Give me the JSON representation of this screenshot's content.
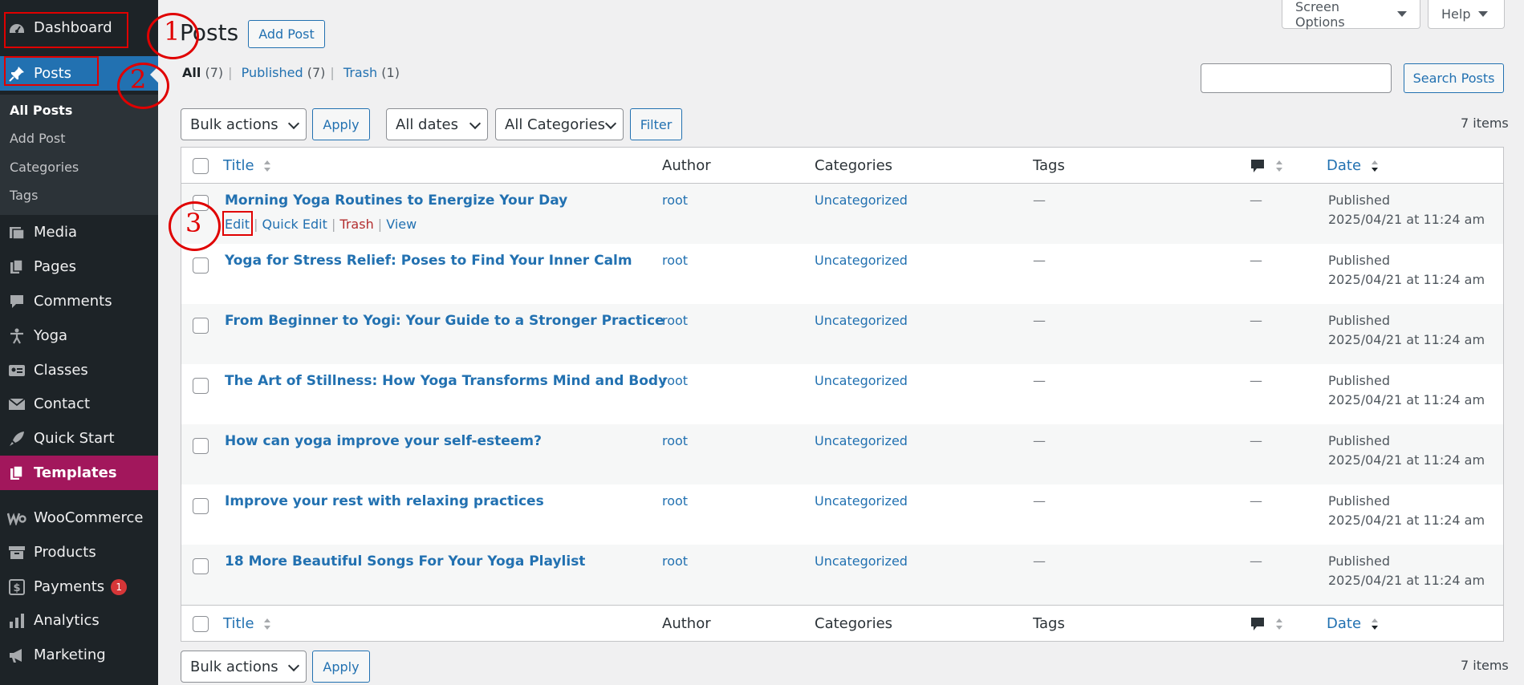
{
  "sidebar": {
    "items": [
      {
        "label": "Dashboard",
        "icon": "dashboard-icon"
      },
      {
        "label": "Posts",
        "icon": "pin-icon"
      },
      {
        "label": "Media",
        "icon": "media-icon"
      },
      {
        "label": "Pages",
        "icon": "pages-icon"
      },
      {
        "label": "Comments",
        "icon": "comments-icon"
      },
      {
        "label": "Yoga",
        "icon": "person-icon"
      },
      {
        "label": "Classes",
        "icon": "classes-icon"
      },
      {
        "label": "Contact",
        "icon": "mail-icon"
      },
      {
        "label": "Quick Start",
        "icon": "rocket-icon"
      },
      {
        "label": "Templates",
        "icon": "templates-icon"
      },
      {
        "label": "WooCommerce",
        "icon": "woo-icon"
      },
      {
        "label": "Products",
        "icon": "archive-icon"
      },
      {
        "label": "Payments",
        "icon": "dollar-icon",
        "badge": "1"
      },
      {
        "label": "Analytics",
        "icon": "bar-chart-icon"
      },
      {
        "label": "Marketing",
        "icon": "megaphone-icon"
      }
    ],
    "submenu": [
      "All Posts",
      "Add Post",
      "Categories",
      "Tags"
    ]
  },
  "header": {
    "title": "Posts",
    "add_button": "Add Post",
    "screen_options": "Screen Options",
    "help": "Help"
  },
  "filters": {
    "all": "All",
    "all_count": "(7)",
    "published": "Published",
    "published_count": "(7)",
    "trash": "Trash",
    "trash_count": "(1)",
    "search_button": "Search Posts",
    "bulk_actions": "Bulk actions",
    "apply": "Apply",
    "all_dates": "All dates",
    "all_categories": "All Categories",
    "filter": "Filter",
    "items_count": "7 items"
  },
  "table": {
    "columns": {
      "title": "Title",
      "author": "Author",
      "categories": "Categories",
      "tags": "Tags",
      "date": "Date"
    },
    "rows": [
      {
        "title": "Morning Yoga Routines to Energize Your Day",
        "author": "root",
        "category": "Uncategorized",
        "tags": "—",
        "comments": "—",
        "status": "Published",
        "date": "2025/04/21 at 11:24 am"
      },
      {
        "title": "Yoga for Stress Relief: Poses to Find Your Inner Calm",
        "author": "root",
        "category": "Uncategorized",
        "tags": "—",
        "comments": "—",
        "status": "Published",
        "date": "2025/04/21 at 11:24 am"
      },
      {
        "title": "From Beginner to Yogi: Your Guide to a Stronger Practice",
        "author": "root",
        "category": "Uncategorized",
        "tags": "—",
        "comments": "—",
        "status": "Published",
        "date": "2025/04/21 at 11:24 am"
      },
      {
        "title": "The Art of Stillness: How Yoga Transforms Mind and Body",
        "author": "root",
        "category": "Uncategorized",
        "tags": "—",
        "comments": "—",
        "status": "Published",
        "date": "2025/04/21 at 11:24 am"
      },
      {
        "title": "How can yoga improve your self-esteem?",
        "author": "root",
        "category": "Uncategorized",
        "tags": "—",
        "comments": "—",
        "status": "Published",
        "date": "2025/04/21 at 11:24 am"
      },
      {
        "title": "Improve your rest with relaxing practices",
        "author": "root",
        "category": "Uncategorized",
        "tags": "—",
        "comments": "—",
        "status": "Published",
        "date": "2025/04/21 at 11:24 am"
      },
      {
        "title": "18 More Beautiful Songs For Your Yoga Playlist",
        "author": "root",
        "category": "Uncategorized",
        "tags": "—",
        "comments": "—",
        "status": "Published",
        "date": "2025/04/21 at 11:24 am"
      }
    ],
    "row_actions": {
      "edit": "Edit",
      "quick_edit": "Quick Edit",
      "trash": "Trash",
      "view": "View"
    }
  },
  "annotations": {
    "one": "1",
    "two": "2",
    "three": "3"
  },
  "colors": {
    "sidebar_bg": "#1d2327",
    "accent": "#2271b1",
    "templates": "#a2175c",
    "annotation": "#e00000"
  }
}
